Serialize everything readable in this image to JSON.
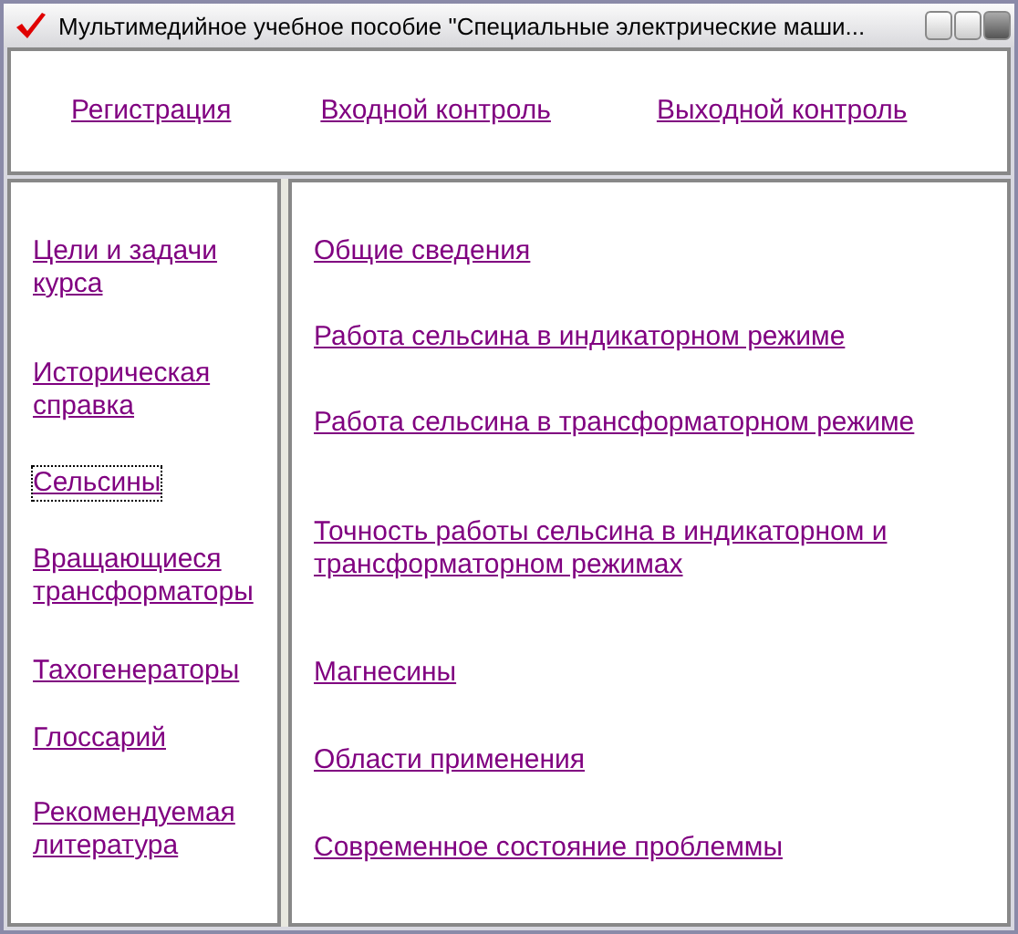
{
  "window": {
    "title": "Мультимедийное учебное пособие \"Специальные электрические маши..."
  },
  "top_links": [
    {
      "label": "Регистрация"
    },
    {
      "label": "Входной контроль"
    },
    {
      "label": "Выходной контроль"
    }
  ],
  "sidebar": {
    "items": [
      {
        "label": "Цели и задачи курса",
        "focused": false
      },
      {
        "label": "Историческая справка",
        "focused": false
      },
      {
        "label": "Сельсины",
        "focused": true
      },
      {
        "label": "Вращающиеся трансформаторы",
        "focused": false
      },
      {
        "label": "Тахогенераторы",
        "focused": false
      },
      {
        "label": "Глоссарий",
        "focused": false
      },
      {
        "label": "Рекомендуемая литература",
        "focused": false
      }
    ]
  },
  "content": {
    "links": [
      {
        "label": "Общие сведения"
      },
      {
        "label": "Работа сельсина в индикаторном режиме"
      },
      {
        "label": "Работа сельсина в трансформаторном режиме"
      },
      {
        "label": "Точность работы сельсина в индикаторном и трансформаторном режимах"
      },
      {
        "label": "Магнесины"
      },
      {
        "label": "Области применения"
      },
      {
        "label": "Современное состояние проблеммы"
      }
    ]
  }
}
